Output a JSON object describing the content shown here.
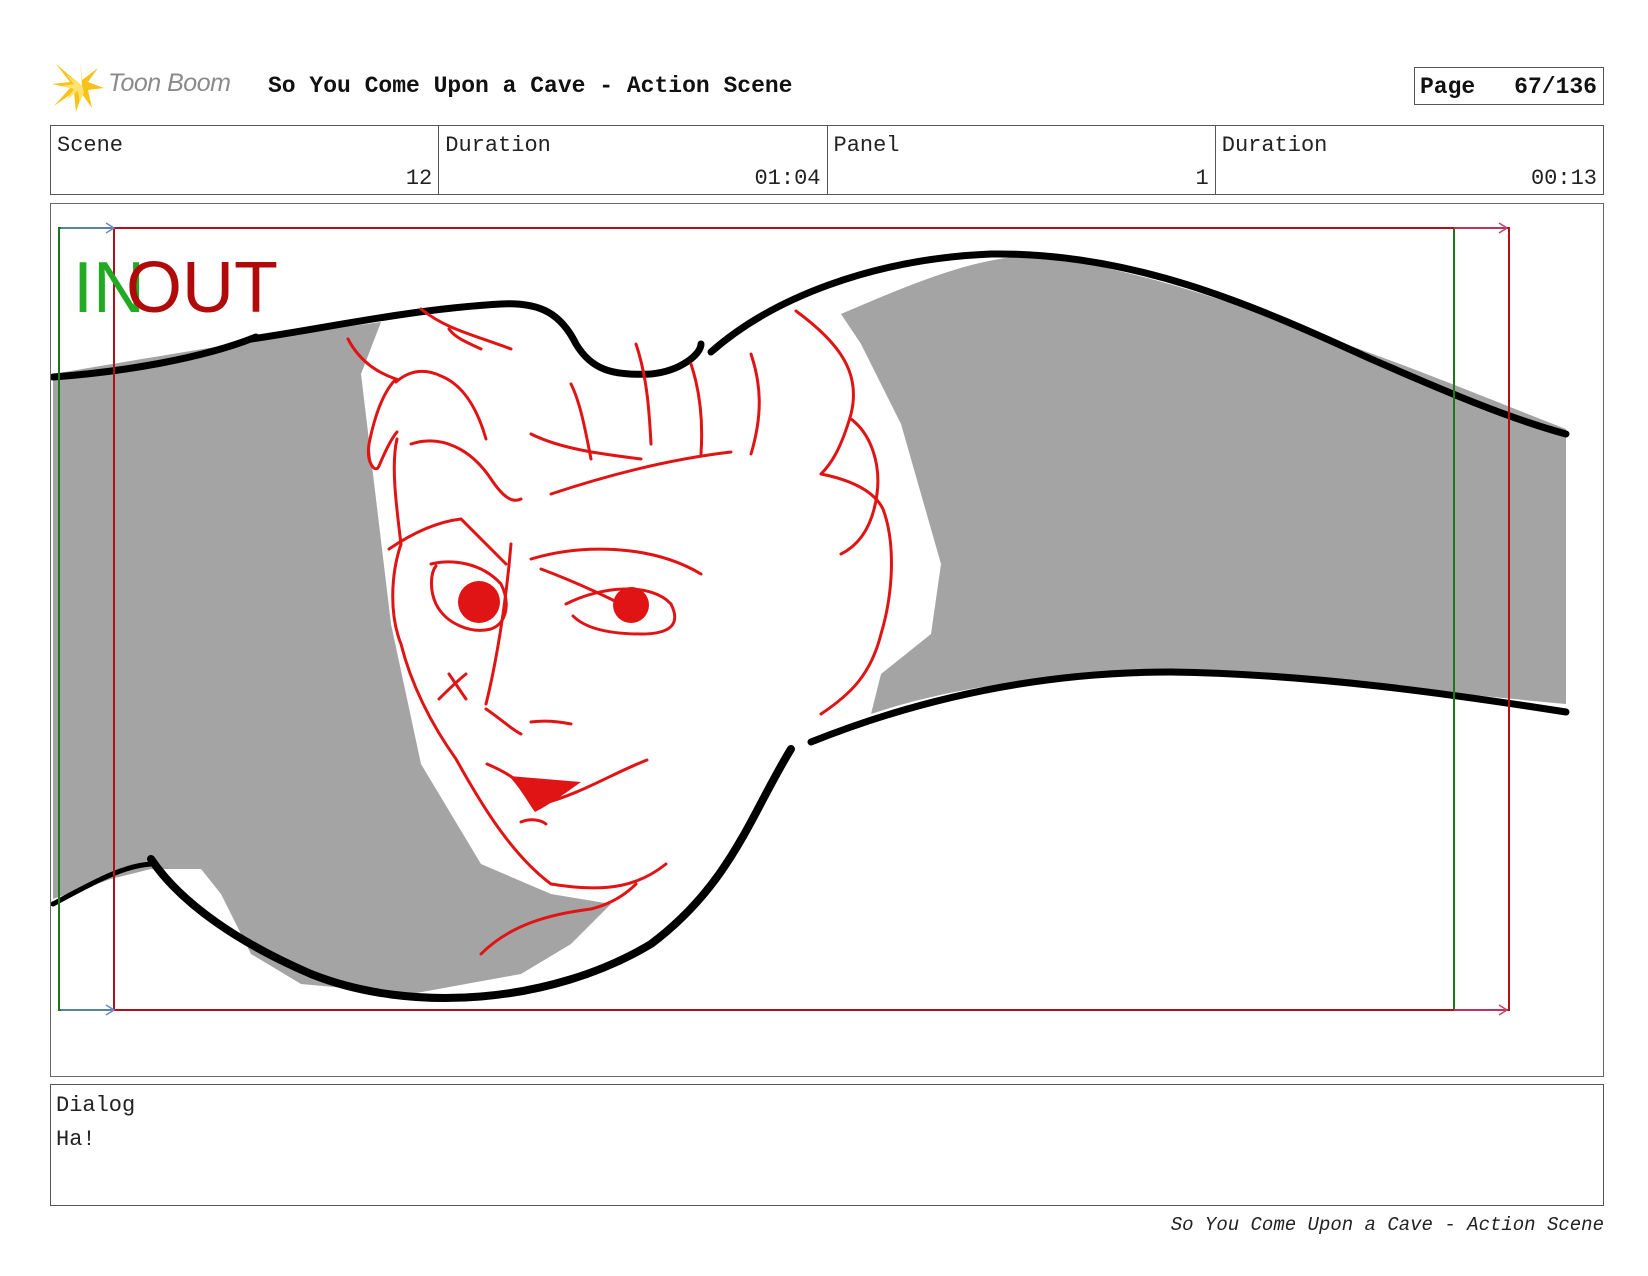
{
  "header": {
    "logo_text": "Toon Boom",
    "title": "So You Come Upon a Cave - Action Scene",
    "page_label": "Page",
    "page_number": "67/136"
  },
  "info": {
    "scene_label": "Scene",
    "scene_value": "12",
    "scene_duration_label": "Duration",
    "scene_duration_value": "01:04",
    "panel_label": "Panel",
    "panel_value": "1",
    "panel_duration_label": "Duration",
    "panel_duration_value": "00:13"
  },
  "panel": {
    "in_label": "IN",
    "out_label": "OUT",
    "colors": {
      "in_frame": "#1a7a1a",
      "out_frame": "#b0101a",
      "in_text": "#22aa22",
      "out_text": "#b00a0a",
      "sketch": "#e01414",
      "shadow": "#a4a4a4"
    }
  },
  "dialog": {
    "label": "Dialog",
    "text": "Ha!"
  },
  "footer": {
    "text": "So You Come Upon a Cave - Action Scene"
  }
}
